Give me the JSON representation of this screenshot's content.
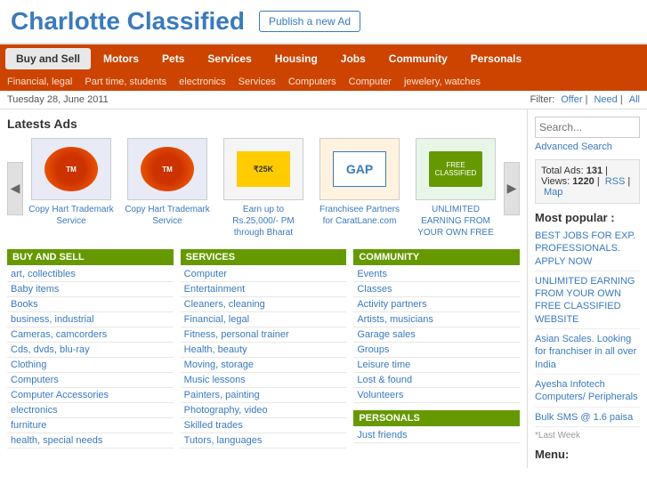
{
  "header": {
    "title_part1": "Charlotte",
    "title_part2": " Classified",
    "publish_btn": "Publish a new Ad"
  },
  "main_nav": {
    "items": [
      {
        "label": "Buy and Sell",
        "active": true
      },
      {
        "label": "Motors",
        "active": false
      },
      {
        "label": "Pets",
        "active": false
      },
      {
        "label": "Services",
        "active": false
      },
      {
        "label": "Housing",
        "active": false
      },
      {
        "label": "Jobs",
        "active": false
      },
      {
        "label": "Community",
        "active": false
      },
      {
        "label": "Personals",
        "active": false
      }
    ]
  },
  "sub_nav": {
    "items": [
      "Financial, legal",
      "Part time, students",
      "electronics",
      "Services",
      "Computers",
      "Computer",
      "jewelery, watches"
    ]
  },
  "date_bar": {
    "date": "Tuesday 28, June 2011",
    "filter_label": "Filter:",
    "filter_offer": "Offer",
    "filter_need": "Need",
    "filter_all": "All"
  },
  "latest_ads": {
    "title": "Latests Ads",
    "ads": [
      {
        "label": "Copy Hart Trademark Service",
        "img_type": "trademark"
      },
      {
        "label": "Copy Hart Trademark Service",
        "img_type": "trademark"
      },
      {
        "label": "Earn up to Rs.25,000/- PM through Bharat",
        "img_type": "earn"
      },
      {
        "label": "Franchisee Partners for CaratLane.com",
        "img_type": "franchise"
      },
      {
        "label": "UNLIMITED EARNING FROM YOUR OWN FREE",
        "img_type": "unlimited"
      }
    ]
  },
  "stats": {
    "label": "Total Ads:",
    "total_ads": "131",
    "views_label": "Views:",
    "views": "1220",
    "rss": "RSS",
    "map": "Map"
  },
  "categories": {
    "buy_and_sell": {
      "header": "BUY AND SELL",
      "items": [
        "art, collectibles",
        "Baby items",
        "Books",
        "business, industrial",
        "Cameras, camcorders",
        "Cds, dvds, blu-ray",
        "Clothing",
        "Computers",
        "Computer Accessories",
        "electronics",
        "furniture",
        "health, special needs"
      ]
    },
    "services": {
      "header": "SERVICES",
      "items": [
        "Computer",
        "Entertainment",
        "Cleaners, cleaning",
        "Financial, legal",
        "Fitness, personal trainer",
        "Health, beauty",
        "Moving, storage",
        "Music lessons",
        "Painters, painting",
        "Photography, video",
        "Skilled trades",
        "Tutors, languages"
      ]
    },
    "community": {
      "header": "COMMUNITY",
      "items": [
        "Events",
        "Classes",
        "Activity partners",
        "Artists, musicians",
        "Garage sales",
        "Groups",
        "Leisure time",
        "Lost & found",
        "Volunteers"
      ]
    },
    "personals": {
      "header": "PERSONALS",
      "items": [
        "Just friends"
      ]
    }
  },
  "most_popular": {
    "title": "Most popular :",
    "items": [
      "BEST JOBS FOR EXP. PROFESSIONALS. APPLY NOW",
      "UNLIMITED EARNING FROM YOUR OWN FREE CLASSIFIED WEBSITE",
      "Asian Scales. Looking for franchiser in all over India",
      "Ayesha Infotech Computers/ Peripherals",
      "Bulk SMS @ 1.6 paisa"
    ],
    "last_week": "*Last Week"
  },
  "menu": {
    "title": "Menu:"
  },
  "search": {
    "placeholder": "Search...",
    "advanced": "Advanced Search"
  }
}
